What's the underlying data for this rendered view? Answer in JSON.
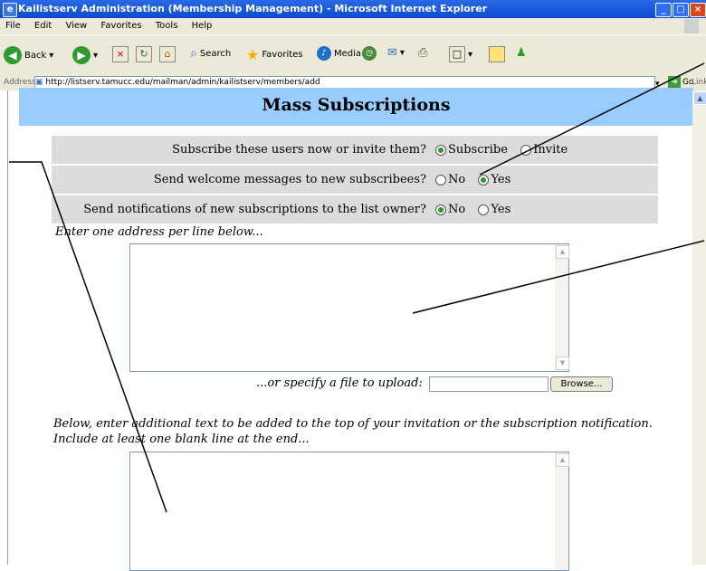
{
  "window": {
    "title": "Kailistserv Administration (Membership Management) - Microsoft Internet Explorer",
    "controls": [
      "minimize",
      "maximize",
      "close"
    ]
  },
  "menu": [
    "File",
    "Edit",
    "View",
    "Favorites",
    "Tools",
    "Help"
  ],
  "toolbar": {
    "back_label": "Back",
    "search_label": "Search",
    "favorites_label": "Favorites",
    "media_label": "Media"
  },
  "address": {
    "label": "Address",
    "url": "http://listserv.tamucc.edu/mailman/admin/kailistserv/members/add",
    "go_label": "Go",
    "links_label": "Links"
  },
  "page": {
    "heading": "Mass Subscriptions",
    "rows": [
      {
        "question": "Subscribe these users now or invite them?",
        "options": [
          "Subscribe",
          "Invite"
        ],
        "selected": 0
      },
      {
        "question": "Send welcome messages to new subscribees?",
        "options": [
          "No",
          "Yes"
        ],
        "selected": 1
      },
      {
        "question": "Send notifications of new subscriptions to the list owner?",
        "options": [
          "No",
          "Yes"
        ],
        "selected": 0
      }
    ],
    "address_prompt": "Enter one address per line below...",
    "upload_prompt": "...or specify a file to upload:",
    "browse_label": "Browse...",
    "extra_text_prompt_line1": "Below, enter additional text to be added to the top of your invitation or the subscription notification.",
    "extra_text_prompt_line2": "Include at least one blank line at the end..."
  },
  "colors": {
    "header_bg": "#99ccff",
    "row_bg": "#dcdcdc",
    "titlebar": "#0a4bd0"
  }
}
